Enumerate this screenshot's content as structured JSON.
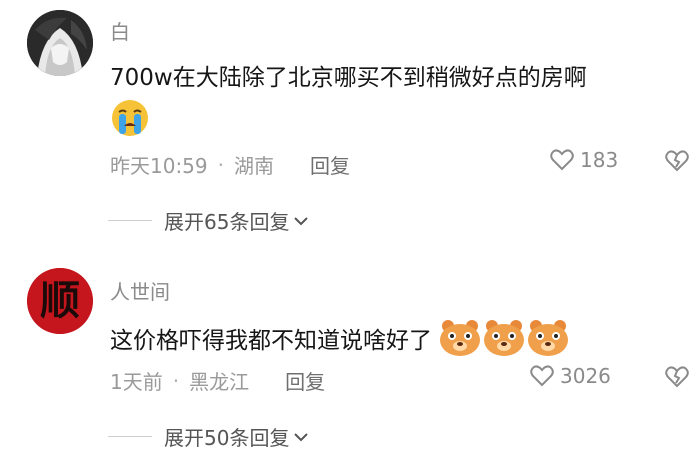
{
  "comments": [
    {
      "username": "白",
      "text": "700w在大陆除了北京哪买不到稍微好点的房啊",
      "emoji": "crying-face-icon",
      "time": "昨天10:59",
      "sep": "·",
      "location": "湖南",
      "reply_label": "回复",
      "likes": "183",
      "expand_label": "展开65条回复"
    },
    {
      "username": "人世间",
      "avatar_text": "顺",
      "text": "这价格吓得我都不知道说啥好了",
      "emoji": "bear-face-icon",
      "time": "1天前",
      "sep": "·",
      "location": "黑龙江",
      "reply_label": "回复",
      "likes": "3026",
      "expand_label": "展开50条回复"
    }
  ],
  "colors": {
    "background": "#ffffff",
    "meta": "#9a9a9a",
    "avatar_red": "#c5161d",
    "emoji_orange": "#f0a04a"
  }
}
